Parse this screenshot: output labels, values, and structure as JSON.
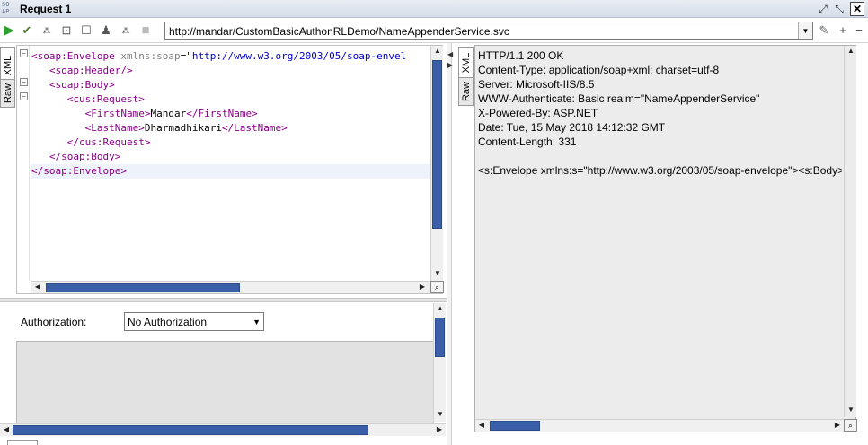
{
  "window": {
    "logo_top": "SO",
    "logo_bottom": "AP",
    "title": "Request 1"
  },
  "toolbar": {
    "url": "http://mandar/CustomBasicAuthonRLDemo/NameAppenderService.svc"
  },
  "request_tabs": [
    "XML",
    "Raw"
  ],
  "request_xml": {
    "lines": [
      {
        "indent": "",
        "open": "<",
        "tag": "soap:Envelope",
        "attr": " xmlns:soap",
        "eq": "=",
        "str": "\"http://www.w3.org/2003/05/soap-envel",
        "close": ""
      },
      {
        "indent": "   ",
        "open": "<",
        "tag": "soap:Header",
        "close": "/>"
      },
      {
        "indent": "   ",
        "open": "<",
        "tag": "soap:Body",
        "close": ">"
      },
      {
        "indent": "      ",
        "open": "<",
        "tag": "cus:Request",
        "close": ">"
      },
      {
        "indent": "         ",
        "open": "<",
        "tag": "FirstName",
        "close": ">",
        "text": "Mandar",
        "end": "</FirstName>"
      },
      {
        "indent": "         ",
        "open": "<",
        "tag": "LastName",
        "close": ">",
        "text": "Dharmadhikari",
        "end": "</LastName>"
      },
      {
        "indent": "      ",
        "open": "</",
        "tag": "cus:Request",
        "close": ">"
      },
      {
        "indent": "   ",
        "open": "</",
        "tag": "soap:Body",
        "close": ">"
      },
      {
        "indent": "",
        "open": "</",
        "tag": "soap:Envelope",
        "close": ">"
      }
    ]
  },
  "auth": {
    "label": "Authorization:",
    "selected": "No Authorization"
  },
  "response_tabs": [
    "XML",
    "Raw"
  ],
  "response_raw": {
    "lines": [
      "HTTP/1.1 200 OK",
      "Content-Type: application/soap+xml; charset=utf-8",
      "Server: Microsoft-IIS/8.5",
      "WWW-Authenticate: Basic realm=\"NameAppenderService\"",
      "X-Powered-By: ASP.NET",
      "Date: Tue, 15 May 2018 14:12:32 GMT",
      "Content-Length: 331",
      "",
      "<s:Envelope xmlns:s=\"http://www.w3.org/2003/05/soap-envelope\"><s:Body><"
    ]
  },
  "colors": {
    "xml_tag": "#880088",
    "xml_attr": "#808080",
    "xml_string": "#0000cc",
    "scroll_thumb": "#3a5ea8"
  }
}
